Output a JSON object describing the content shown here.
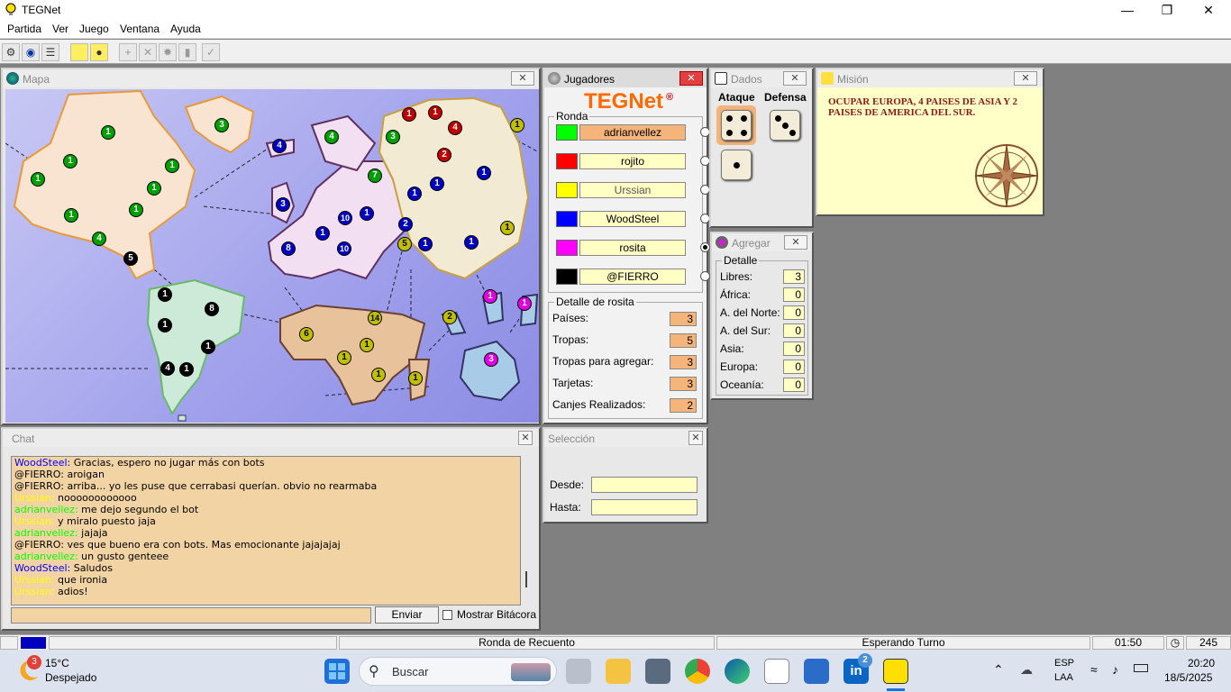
{
  "app": {
    "title": "TEGNet"
  },
  "menu": [
    "Partida",
    "Ver",
    "Juego",
    "Ventana",
    "Ayuda"
  ],
  "toolbar": {
    "icons": [
      "connect-icon",
      "globe-icon",
      "list-icon",
      "card-icon",
      "lightbulb-icon",
      "add-army-icon",
      "attack-icon",
      "move-icon",
      "cards-icon",
      "end-turn-icon"
    ]
  },
  "map": {
    "title": "Mapa",
    "armies": [
      {
        "n": "1",
        "c": "#00a000"
      },
      {
        "n": "3",
        "c": "#00a000"
      },
      {
        "n": "1",
        "c": "#00a000"
      },
      {
        "n": "1",
        "c": "#00a000"
      },
      {
        "n": "1",
        "c": "#00a000"
      },
      {
        "n": "1",
        "c": "#00a000"
      },
      {
        "n": "1",
        "c": "#00a000"
      },
      {
        "n": "1",
        "c": "#00a000"
      },
      {
        "n": "4",
        "c": "#00a000"
      },
      {
        "n": "5",
        "c": "#000"
      },
      {
        "n": "4",
        "c": "#0000c0"
      },
      {
        "n": "3",
        "c": "#0000c0"
      },
      {
        "n": "8",
        "c": "#0000c0"
      },
      {
        "n": "1",
        "c": "#0000c0"
      },
      {
        "n": "1",
        "c": "#0000c0"
      },
      {
        "n": "10",
        "c": "#0000c0"
      },
      {
        "n": "1",
        "c": "#0000c0"
      },
      {
        "n": "1",
        "c": "#0000c0"
      },
      {
        "n": "10",
        "c": "#0000c0"
      },
      {
        "n": "2",
        "c": "#0000c0"
      },
      {
        "n": "1",
        "c": "#0000c0"
      },
      {
        "n": "1",
        "c": "#0000c0"
      },
      {
        "n": "1",
        "c": "#0000c0"
      },
      {
        "n": "4",
        "c": "#00a000"
      },
      {
        "n": "7",
        "c": "#00a000"
      },
      {
        "n": "3",
        "c": "#00a000"
      },
      {
        "n": "1",
        "c": "#c00000"
      },
      {
        "n": "1",
        "c": "#c00000"
      },
      {
        "n": "4",
        "c": "#c00000"
      },
      {
        "n": "2",
        "c": "#c00000"
      },
      {
        "n": "1",
        "c": "#c0c000"
      },
      {
        "n": "1",
        "c": "#c0c000"
      },
      {
        "n": "5",
        "c": "#c0c000"
      },
      {
        "n": "6",
        "c": "#c0c000"
      },
      {
        "n": "14",
        "c": "#c0c000"
      },
      {
        "n": "1",
        "c": "#c0c000"
      },
      {
        "n": "1",
        "c": "#c0c000"
      },
      {
        "n": "1",
        "c": "#c0c000"
      },
      {
        "n": "1",
        "c": "#c0c000"
      },
      {
        "n": "2",
        "c": "#c0c000"
      },
      {
        "n": "1",
        "c": "#000"
      },
      {
        "n": "8",
        "c": "#000"
      },
      {
        "n": "1",
        "c": "#000"
      },
      {
        "n": "1",
        "c": "#000"
      },
      {
        "n": "4",
        "c": "#000"
      },
      {
        "n": "1",
        "c": "#000"
      },
      {
        "n": "1",
        "c": "#e000e0"
      },
      {
        "n": "1",
        "c": "#e000e0"
      },
      {
        "n": "3",
        "c": "#e000e0"
      }
    ]
  },
  "players": {
    "title": "Jugadores",
    "logo": "TEGNet",
    "logo_mark": "®",
    "round_label": "Ronda",
    "list": [
      {
        "name": "adrianvellez",
        "color": "#00ff00",
        "active": false,
        "highlight": true
      },
      {
        "name": "rojito",
        "color": "#ff0000",
        "active": false,
        "highlight": false
      },
      {
        "name": "Urssian",
        "color": "#ffff00",
        "active": false,
        "highlight": false
      },
      {
        "name": "WoodSteel",
        "color": "#0000ff",
        "active": false,
        "highlight": false
      },
      {
        "name": "rosita",
        "color": "#ff00ff",
        "active": true,
        "highlight": false
      },
      {
        "name": "@FIERRO",
        "color": "#000000",
        "active": false,
        "highlight": false
      }
    ],
    "detail_label": "Detalle de rosita",
    "detail": [
      {
        "label": "Países:",
        "value": "3"
      },
      {
        "label": "Tropas:",
        "value": "5"
      },
      {
        "label": "Tropas para agregar:",
        "value": "3"
      },
      {
        "label": "Tarjetas:",
        "value": "3"
      },
      {
        "label": "Canjes Realizados:",
        "value": "2"
      }
    ]
  },
  "dice": {
    "title": "Dados",
    "attack_label": "Ataque",
    "defense_label": "Defensa",
    "attack": [
      4,
      1
    ],
    "defense": [
      3
    ]
  },
  "mission": {
    "title": "Misión",
    "text": "OCUPAR EUROPA, 4 PAISES DE ASIA Y 2 PAISES DE AMERICA DEL SUR."
  },
  "add": {
    "title": "Agregar",
    "detail_label": "Detalle",
    "rows": [
      {
        "label": "Libres:",
        "value": "3"
      },
      {
        "label": "África:",
        "value": "0"
      },
      {
        "label": "A. del Norte:",
        "value": "0"
      },
      {
        "label": "A. del Sur:",
        "value": "0"
      },
      {
        "label": "Asia:",
        "value": "0"
      },
      {
        "label": "Europa:",
        "value": "0"
      },
      {
        "label": "Oceanía:",
        "value": "0"
      }
    ]
  },
  "selection": {
    "title": "Selección",
    "from_label": "Desde:",
    "to_label": "Hasta:",
    "from_value": "",
    "to_value": ""
  },
  "chat": {
    "title": "Chat",
    "send_label": "Enviar",
    "log_label": "Mostrar Bitácora",
    "input_value": "",
    "messages": [
      {
        "who": "WoodSteel",
        "color": "#0000ff",
        "text": "Gracias, espero no jugar más con bots"
      },
      {
        "who": "@FIERRO",
        "color": "#000000",
        "text": "aroigan"
      },
      {
        "who": "@FIERRO",
        "color": "#000000",
        "text": "arriba... yo les puse que cerrabasi querían. obvio no rearmaba"
      },
      {
        "who": "Urssian",
        "color": "#ffff00",
        "text": "noooooooooooo"
      },
      {
        "who": "adrianvellez",
        "color": "#00ff00",
        "text": "me dejo segundo el bot"
      },
      {
        "who": "Urssian",
        "color": "#ffff00",
        "text": "y miralo puesto jaja"
      },
      {
        "who": "adrianvellez",
        "color": "#00ff00",
        "text": "jajaja"
      },
      {
        "who": "@FIERRO",
        "color": "#000000",
        "text": "ves que bueno era con bots. Mas emocionante jajajajaj"
      },
      {
        "who": "adrianvellez",
        "color": "#00ff00",
        "text": "un gusto genteee"
      },
      {
        "who": "WoodSteel",
        "color": "#0000ff",
        "text": "Saludos"
      },
      {
        "who": "Urssian",
        "color": "#ffff00",
        "text": "que ironia"
      },
      {
        "who": "Urssian",
        "color": "#ffff00",
        "text": "adios!"
      }
    ]
  },
  "status": {
    "round": "Ronda de Recuento",
    "turn": "Esperando Turno",
    "time": "01:50",
    "count": "245",
    "player_color": "#0000c0"
  },
  "taskbar": {
    "weather_temp": "15°C",
    "weather_desc": "Despejado",
    "weather_badge": "3",
    "search_placeholder": "Buscar",
    "lang": "ESP",
    "lang2": "LAA",
    "time": "20:20",
    "date": "18/5/2025",
    "linkedin_badge": "2"
  }
}
